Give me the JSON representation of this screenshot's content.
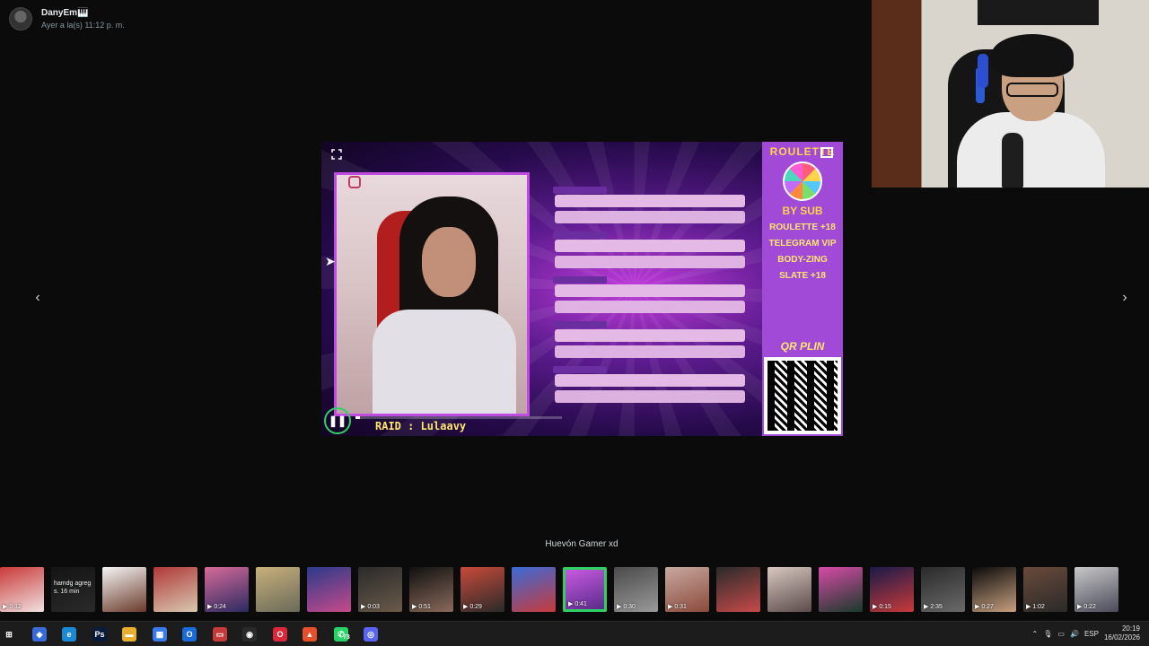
{
  "message": {
    "sender_name": "DanyEm🎹",
    "timestamp": "Ayer a la(s) 11:12 p. m.",
    "caption": "Huevón Gamer xd"
  },
  "nav": {
    "prev_icon": "‹",
    "next_icon": "›"
  },
  "video": {
    "state": "playing",
    "progress": 0.02,
    "raid_text": "RAID : Lulaavy",
    "roulette": {
      "title": "ROULETTE",
      "by_sub": "BY SUB",
      "prizes": [
        "ROULETTE +18",
        "TELEGRAM VIP",
        "BODY-ZING",
        "SLATE +18"
      ],
      "qr_label": "QR PLIN"
    }
  },
  "thumbnails": [
    {
      "duration": "0:12",
      "colors": [
        "#c93a3a",
        "#f1e0e0"
      ]
    },
    {
      "text": "hamdg agreg\ns. 16 min",
      "colors": [
        "#141414",
        "#2a2a2a"
      ]
    },
    {
      "duration": "",
      "colors": [
        "#f5f5f5",
        "#6a3a2a"
      ]
    },
    {
      "duration": "",
      "colors": [
        "#b03838",
        "#d8c8b0"
      ]
    },
    {
      "duration": "0:24",
      "colors": [
        "#d86a9a",
        "#2a2a60"
      ]
    },
    {
      "duration": "",
      "colors": [
        "#c8b07a",
        "#6a6a5a"
      ]
    },
    {
      "duration": "",
      "colors": [
        "#2a3a8a",
        "#c84a8a"
      ]
    },
    {
      "duration": "0:03",
      "colors": [
        "#2a2a2a",
        "#6a5a4a"
      ]
    },
    {
      "duration": "0:51",
      "colors": [
        "#101010",
        "#8a6a5a"
      ]
    },
    {
      "duration": "0:29",
      "colors": [
        "#c84a3a",
        "#2a2a2a"
      ]
    },
    {
      "duration": "",
      "colors": [
        "#3a6ad8",
        "#c83a3a"
      ]
    },
    {
      "duration": "0:41",
      "colors": [
        "#c85ae0",
        "#5a2a8a"
      ],
      "active": true
    },
    {
      "duration": "0:30",
      "colors": [
        "#4a4a4a",
        "#9a9a9a"
      ]
    },
    {
      "duration": "0:31",
      "colors": [
        "#c8a8a0",
        "#8a4a3a"
      ]
    },
    {
      "duration": "",
      "colors": [
        "#2a2a2a",
        "#c84a4a"
      ]
    },
    {
      "duration": "",
      "colors": [
        "#d8c8c0",
        "#5a4a4a"
      ]
    },
    {
      "duration": "",
      "colors": [
        "#d84aa8",
        "#1a3a2a"
      ]
    },
    {
      "duration": "0:15",
      "colors": [
        "#1a1a4a",
        "#c83a3a"
      ]
    },
    {
      "duration": "2:35",
      "colors": [
        "#2a2a2a",
        "#6a6a6a"
      ]
    },
    {
      "duration": "0:27",
      "colors": [
        "#0a0a0a",
        "#c8a080"
      ]
    },
    {
      "duration": "1:02",
      "colors": [
        "#6a4a3a",
        "#2a2a2a"
      ]
    },
    {
      "duration": "0:22",
      "colors": [
        "#c8c8c8",
        "#4a4a5a"
      ]
    }
  ],
  "taskbar": {
    "apps": [
      {
        "name": "windows-start-icon",
        "label": "⊞",
        "color": "#1c1c1c"
      },
      {
        "name": "copilot-icon",
        "label": "◆",
        "color": "#3a6ad8"
      },
      {
        "name": "edge-icon",
        "label": "e",
        "color": "#1a8ad8"
      },
      {
        "name": "photoshop-icon",
        "label": "Ps",
        "color": "#0a1a3a"
      },
      {
        "name": "file-explorer-icon",
        "label": "▬",
        "color": "#e8b030"
      },
      {
        "name": "store-icon",
        "label": "▦",
        "color": "#3a7ae8"
      },
      {
        "name": "outlook-icon",
        "label": "O",
        "color": "#1a6ad8"
      },
      {
        "name": "app-red-icon",
        "label": "▭",
        "color": "#c83a3a"
      },
      {
        "name": "obs-icon",
        "label": "◉",
        "color": "#2a2a2a"
      },
      {
        "name": "opera-icon",
        "label": "O",
        "color": "#d8283a"
      },
      {
        "name": "brave-icon",
        "label": "▲",
        "color": "#e8502a"
      },
      {
        "name": "whatsapp-icon",
        "label": "✆",
        "color": "#25d366",
        "badge": "73"
      },
      {
        "name": "discord-icon",
        "label": "◎",
        "color": "#5865f2"
      }
    ],
    "language": "ESP",
    "time": "20:19",
    "date": "16/02/2026"
  }
}
